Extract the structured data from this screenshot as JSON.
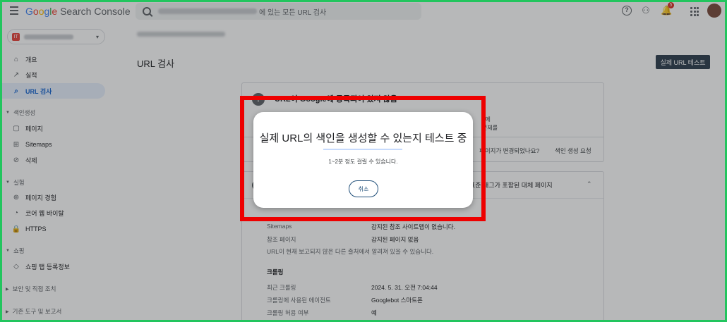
{
  "header": {
    "brand_parts": [
      "G",
      "o",
      "o",
      "g",
      "l",
      "e"
    ],
    "brand_suffix": " Search Console",
    "search_suffix": "에 있는 모든 URL 검사",
    "help_icon": "help-icon",
    "notifications_count": "5"
  },
  "sidebar": {
    "property_badge": "IT",
    "items": [
      {
        "label": "개요",
        "icon": "⌂"
      },
      {
        "label": "실적",
        "icon": "↗"
      },
      {
        "label": "URL 검사",
        "icon": "⌕"
      }
    ],
    "sections": [
      {
        "label": "색인생성",
        "items": [
          {
            "label": "페이지",
            "icon": "▢"
          },
          {
            "label": "Sitemaps",
            "icon": "⊞"
          },
          {
            "label": "삭제",
            "icon": "⊘"
          }
        ]
      },
      {
        "label": "실험",
        "items": [
          {
            "label": "페이지 경험",
            "icon": "⊕"
          },
          {
            "label": "코어 웹 바이탈",
            "icon": "◔"
          },
          {
            "label": "HTTPS",
            "icon": "🔒"
          }
        ]
      },
      {
        "label": "쇼핑",
        "items": [
          {
            "label": "쇼핑 탭 등록정보",
            "icon": "◇"
          }
        ]
      }
    ],
    "collapsed_sections": [
      "보안 및 직접 조치",
      "기존 도구 및 보고서"
    ]
  },
  "main": {
    "title": "URL 검사",
    "live_test_button": "실제 URL 테스트",
    "card1": {
      "title": "URL이 Google에 등록되어 있지 않음",
      "desc_right_1": "e에",
      "desc_right_2": "문제를",
      "question": "페이지가 변경되었나요?",
      "request_index": "색인 생성 요청"
    },
    "card2": {
      "header": "표준 태그가 포함된 대체 페이지",
      "rows": {
        "sitemaps_label": "Sitemaps",
        "sitemaps_value": "감지된 참조 사이트맵이 없습니다.",
        "referrer_label": "참조 페이지",
        "referrer_value": "감지된 페이지 없음",
        "note": "URL이 현재 보고되지 않은 다른 출처에서 알려져 있을 수 있습니다.",
        "crawl_heading": "크롤링",
        "last_crawl_label": "최근 크롤링",
        "last_crawl_value": "2024. 5. 31. 오전 7:04:44",
        "agent_label": "크롤링에 사용된 에이전트",
        "agent_value": "Googlebot 스마트폰",
        "allowed_label": "크롤링 허용 여부",
        "allowed_value": "예"
      }
    }
  },
  "dialog": {
    "title": "실제 URL의 색인을 생성할 수 있는지 테스트 중",
    "subtitle": "1~2분 정도 걸릴 수 있습니다.",
    "cancel": "취소",
    "progress": 0.0
  }
}
